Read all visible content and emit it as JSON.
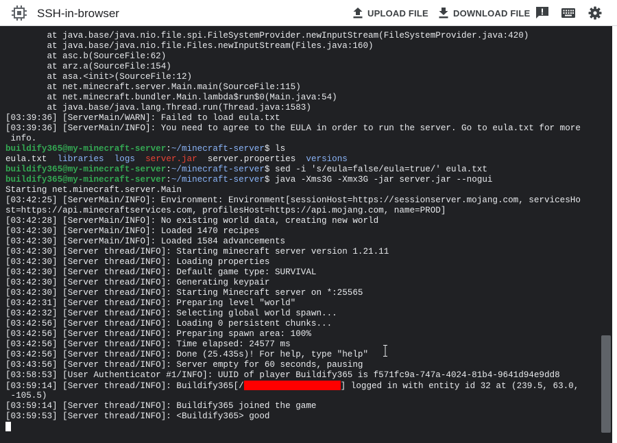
{
  "app": {
    "title": "SSH-in-browser"
  },
  "toolbar": {
    "upload_label": "UPLOAD FILE",
    "download_label": "DOWNLOAD FILE",
    "icons": [
      "upload-icon",
      "download-icon",
      "feedback-icon",
      "keyboard-icon",
      "settings-icon"
    ]
  },
  "colors": {
    "terminal_bg": "#202124",
    "prompt": "#34a853",
    "directory": "#8ab4f8",
    "executable": "#ea4335",
    "redaction": "#ff0000"
  },
  "terminal": {
    "lines": [
      {
        "text": "        at java.base/java.nio.file.spi.FileSystemProvider.newInputStream(FileSystemProvider.java:420)"
      },
      {
        "text": "        at java.base/java.nio.file.Files.newInputStream(Files.java:160)"
      },
      {
        "text": "        at asc.b(SourceFile:62)"
      },
      {
        "text": "        at arz.a(SourceFile:154)"
      },
      {
        "text": "        at asa.<init>(SourceFile:12)"
      },
      {
        "text": "        at net.minecraft.server.Main.main(SourceFile:115)"
      },
      {
        "text": "        at net.minecraft.bundler.Main.lambda$run$0(Main.java:54)"
      },
      {
        "text": "        at java.base/java.lang.Thread.run(Thread.java:1583)"
      },
      {
        "text": "[03:39:36] [ServerMain/WARN]: Failed to load eula.txt"
      },
      {
        "text": "[03:39:36] [ServerMain/INFO]: You need to agree to the EULA in order to run the server. Go to eula.txt for more"
      },
      {
        "text": " info."
      },
      {
        "prompt": {
          "userhost": "buildify365@my-minecraft-server",
          "path": "~/minecraft-server",
          "symbol": "$",
          "command": " ls"
        }
      },
      {
        "segments": [
          {
            "text": "eula.txt  ",
            "cls": ""
          },
          {
            "text": "libraries",
            "cls": "c-blue"
          },
          {
            "text": "  ",
            "cls": ""
          },
          {
            "text": "logs",
            "cls": "c-blue"
          },
          {
            "text": "  ",
            "cls": ""
          },
          {
            "text": "server.jar",
            "cls": "c-red"
          },
          {
            "text": "  server.properties  ",
            "cls": ""
          },
          {
            "text": "versions",
            "cls": "c-blue"
          }
        ]
      },
      {
        "prompt": {
          "userhost": "buildify365@my-minecraft-server",
          "path": "~/minecraft-server",
          "symbol": "$",
          "command": " sed -i 's/eula=false/eula=true/' eula.txt"
        }
      },
      {
        "prompt": {
          "userhost": "buildify365@my-minecraft-server",
          "path": "~/minecraft-server",
          "symbol": "$",
          "command": " java -Xms3G -Xmx3G -jar server.jar --nogui"
        }
      },
      {
        "text": "Starting net.minecraft.server.Main"
      },
      {
        "text": "[03:42:25] [ServerMain/INFO]: Environment: Environment[sessionHost=https://sessionserver.mojang.com, servicesHo"
      },
      {
        "text": "st=https://api.minecraftservices.com, profilesHost=https://api.mojang.com, name=PROD]"
      },
      {
        "text": "[03:42:28] [ServerMain/INFO]: No existing world data, creating new world"
      },
      {
        "text": "[03:42:30] [ServerMain/INFO]: Loaded 1470 recipes"
      },
      {
        "text": "[03:42:30] [ServerMain/INFO]: Loaded 1584 advancements"
      },
      {
        "text": "[03:42:30] [Server thread/INFO]: Starting minecraft server version 1.21.11"
      },
      {
        "text": "[03:42:30] [Server thread/INFO]: Loading properties"
      },
      {
        "text": "[03:42:30] [Server thread/INFO]: Default game type: SURVIVAL"
      },
      {
        "text": "[03:42:30] [Server thread/INFO]: Generating keypair"
      },
      {
        "text": "[03:42:30] [Server thread/INFO]: Starting Minecraft server on *:25565"
      },
      {
        "text": "[03:42:31] [Server thread/INFO]: Preparing level \"world\""
      },
      {
        "text": "[03:42:32] [Server thread/INFO]: Selecting global world spawn..."
      },
      {
        "text": "[03:42:56] [Server thread/INFO]: Loading 0 persistent chunks..."
      },
      {
        "text": "[03:42:56] [Server thread/INFO]: Preparing spawn area: 100%"
      },
      {
        "text": "[03:42:56] [Server thread/INFO]: Time elapsed: 24577 ms"
      },
      {
        "text": "[03:42:56] [Server thread/INFO]: Done (25.435s)! For help, type \"help\""
      },
      {
        "text": "[03:43:56] [Server thread/INFO]: Server empty for 60 seconds, pausing"
      },
      {
        "text": "[03:58:53] [User Authenticator #1/INFO]: UUID of player Buildify365 is f571fc9a-747a-4024-81b4-9641d94e9dd8"
      },
      {
        "redacted": {
          "before": "[03:59:14] [Server thread/INFO]: Buildify365[/",
          "after": "] logged in with entity id 32 at (239.5, 63.0,"
        }
      },
      {
        "text": " -105.5)"
      },
      {
        "text": "[03:59:14] [Server thread/INFO]: Buildify365 joined the game"
      },
      {
        "text": "[03:59:53] [Server thread/INFO]: <Buildify365> good"
      },
      {
        "cursor": true
      }
    ]
  }
}
